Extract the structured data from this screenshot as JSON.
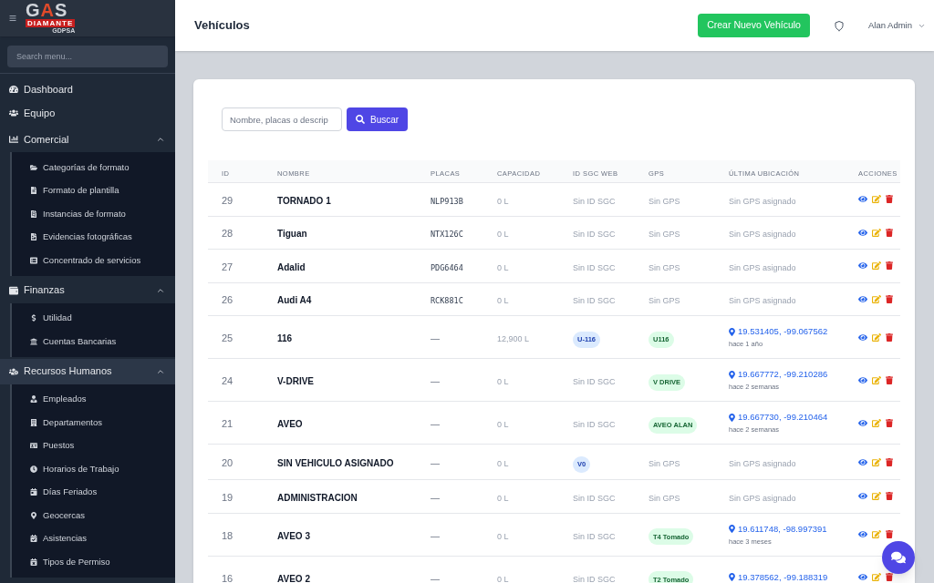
{
  "sidebar": {
    "logo": {
      "wordmark": "GAS",
      "banner": "DIAMANTE",
      "subtitle": "GDPSA"
    },
    "search": {
      "placeholder": "Search menu..."
    },
    "items": [
      {
        "label": "Dashboard",
        "kind": "link",
        "selected": false
      },
      {
        "label": "Equipo",
        "kind": "link",
        "selected": false
      },
      {
        "label": "Comercial",
        "kind": "group",
        "selected": false,
        "expanded": true,
        "children": [
          {
            "label": "Categorías de formato"
          },
          {
            "label": "Formato de plantilla"
          },
          {
            "label": "Instancias de formato"
          },
          {
            "label": "Evidencias fotográficas"
          },
          {
            "label": "Concentrado de servicios"
          }
        ]
      },
      {
        "label": "Finanzas",
        "kind": "group",
        "selected": false,
        "expanded": true,
        "children": [
          {
            "label": "Utilidad"
          },
          {
            "label": "Cuentas Bancarias"
          }
        ]
      },
      {
        "label": "Recursos Humanos",
        "kind": "group",
        "selected": true,
        "expanded": true,
        "children": [
          {
            "label": "Empleados"
          },
          {
            "label": "Departamentos"
          },
          {
            "label": "Puestos"
          },
          {
            "label": "Horarios de Trabajo"
          },
          {
            "label": "Días Feriados"
          },
          {
            "label": "Geocercas"
          },
          {
            "label": "Asistencias"
          },
          {
            "label": "Tipos de Permiso"
          }
        ]
      }
    ]
  },
  "header": {
    "title": "Vehículos",
    "create_button": "Crear Nuevo Vehículo",
    "user": "Alan Admin"
  },
  "search": {
    "placeholder": "Nombre, placas o descrip",
    "button": "Buscar"
  },
  "table": {
    "columns": [
      "ID",
      "NOMBRE",
      "PLACAS",
      "CAPACIDAD",
      "ID SGC WEB",
      "GPS",
      "ÚLTIMA UBICACIÓN",
      "ACCIONES"
    ],
    "rows": [
      {
        "id": "29",
        "name": "TORNADO 1",
        "plates": {
          "kind": "plate",
          "text": "NLP913B"
        },
        "capacity": "0 L",
        "sgc_id": {
          "kind": "text",
          "text": "Sin ID SGC"
        },
        "gps": {
          "kind": "text",
          "text": "Sin GPS"
        },
        "location": {
          "kind": "none",
          "text": "Sin GPS asignado"
        }
      },
      {
        "id": "28",
        "name": "Tiguan",
        "plates": {
          "kind": "plate",
          "text": "NTX126C"
        },
        "capacity": "0 L",
        "sgc_id": {
          "kind": "text",
          "text": "Sin ID SGC"
        },
        "gps": {
          "kind": "text",
          "text": "Sin GPS"
        },
        "location": {
          "kind": "none",
          "text": "Sin GPS asignado"
        }
      },
      {
        "id": "27",
        "name": "Adalid",
        "plates": {
          "kind": "plate",
          "text": "PDG6464"
        },
        "capacity": "0 L",
        "sgc_id": {
          "kind": "text",
          "text": "Sin ID SGC"
        },
        "gps": {
          "kind": "text",
          "text": "Sin GPS"
        },
        "location": {
          "kind": "none",
          "text": "Sin GPS asignado"
        }
      },
      {
        "id": "26",
        "name": "Audi A4",
        "plates": {
          "kind": "plate",
          "text": "RCK881C"
        },
        "capacity": "0 L",
        "sgc_id": {
          "kind": "text",
          "text": "Sin ID SGC"
        },
        "gps": {
          "kind": "text",
          "text": "Sin GPS"
        },
        "location": {
          "kind": "none",
          "text": "Sin GPS asignado"
        }
      },
      {
        "id": "25",
        "name": "116",
        "plates": {
          "kind": "none",
          "text": "—"
        },
        "capacity": "12,900 L",
        "sgc_id": {
          "kind": "badge",
          "text": "U-116"
        },
        "gps": {
          "kind": "badge",
          "text": "U116"
        },
        "location": {
          "kind": "coords",
          "coords": "19.531405, -99.067562",
          "ago": "hace 1 año"
        }
      },
      {
        "id": "24",
        "name": "V-DRIVE",
        "plates": {
          "kind": "none",
          "text": "—"
        },
        "capacity": "0 L",
        "sgc_id": {
          "kind": "text",
          "text": "Sin ID SGC"
        },
        "gps": {
          "kind": "badge",
          "text": "V DRIVE"
        },
        "location": {
          "kind": "coords",
          "coords": "19.667772, -99.210286",
          "ago": "hace 2 semanas"
        }
      },
      {
        "id": "21",
        "name": "AVEO",
        "plates": {
          "kind": "none",
          "text": "—"
        },
        "capacity": "0 L",
        "sgc_id": {
          "kind": "text",
          "text": "Sin ID SGC"
        },
        "gps": {
          "kind": "badge",
          "text": "AVEO ALAN"
        },
        "location": {
          "kind": "coords",
          "coords": "19.667730, -99.210464",
          "ago": "hace 2 semanas"
        }
      },
      {
        "id": "20",
        "name": "SIN VEHICULO ASIGNADO",
        "plates": {
          "kind": "none",
          "text": "—"
        },
        "capacity": "0 L",
        "sgc_id": {
          "kind": "badge",
          "text": "V0"
        },
        "gps": {
          "kind": "text",
          "text": "Sin GPS"
        },
        "location": {
          "kind": "none",
          "text": "Sin GPS asignado"
        }
      },
      {
        "id": "19",
        "name": "ADMINISTRACION",
        "plates": {
          "kind": "none",
          "text": "—"
        },
        "capacity": "0 L",
        "sgc_id": {
          "kind": "text",
          "text": "Sin ID SGC"
        },
        "gps": {
          "kind": "text",
          "text": "Sin GPS"
        },
        "location": {
          "kind": "none",
          "text": "Sin GPS asignado"
        }
      },
      {
        "id": "18",
        "name": "AVEO 3",
        "plates": {
          "kind": "none",
          "text": "—"
        },
        "capacity": "0 L",
        "sgc_id": {
          "kind": "text",
          "text": "Sin ID SGC"
        },
        "gps": {
          "kind": "badge",
          "text": "T4 Tomado"
        },
        "location": {
          "kind": "coords",
          "coords": "19.611748, -98.997391",
          "ago": "hace 3 meses"
        }
      },
      {
        "id": "16",
        "name": "AVEO 2",
        "plates": {
          "kind": "none",
          "text": "—"
        },
        "capacity": "0 L",
        "sgc_id": {
          "kind": "text",
          "text": "Sin ID SGC"
        },
        "gps": {
          "kind": "badge",
          "text": "T2 Tomado"
        },
        "location": {
          "kind": "coords",
          "coords": "19.378562, -99.188319"
        }
      }
    ]
  }
}
